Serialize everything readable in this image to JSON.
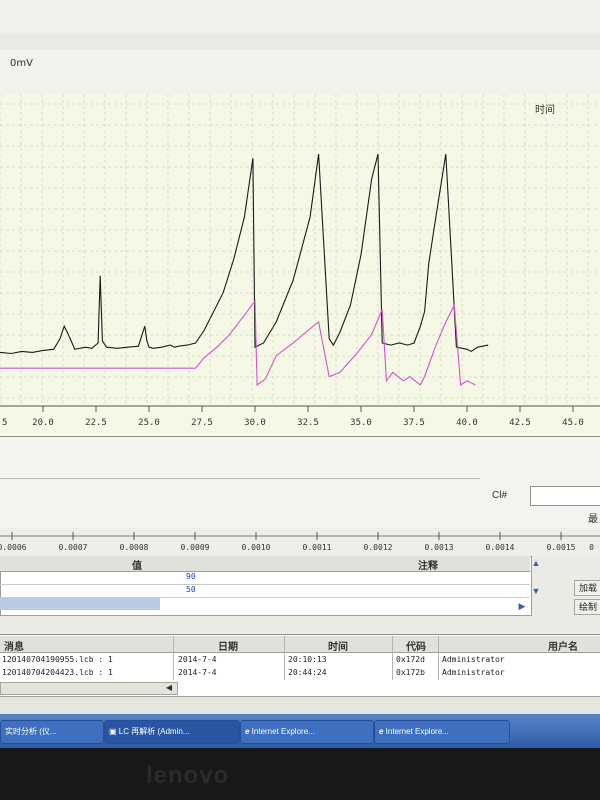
{
  "chart": {
    "ylabel": "0mV",
    "xlabel_right": "时间",
    "x_ticks": [
      "20.0",
      "22.5",
      "25.0",
      "27.5",
      "30.0",
      "32.5",
      "35.0",
      "37.5",
      "40.0",
      "42.5",
      "45.0"
    ],
    "left_tick_fragment": "5"
  },
  "chart_data": {
    "type": "line",
    "xlabel": "时间",
    "ylabel": "0mV",
    "xlim": [
      17.5,
      46.0
    ],
    "series": [
      {
        "name": "",
        "color": "#1a1a1a",
        "x": [
          17.5,
          18.0,
          18.5,
          19.0,
          19.5,
          20.0,
          20.5,
          20.8,
          21.0,
          21.2,
          21.5,
          22.0,
          22.3,
          22.6,
          22.7,
          22.8,
          23.0,
          23.5,
          24.0,
          24.5,
          24.8,
          24.9,
          25.0,
          25.2,
          25.6,
          26.0,
          26.2,
          26.4,
          26.8,
          27.2,
          27.6,
          28.0,
          28.5,
          29.0,
          29.5,
          29.9,
          30.0,
          30.4,
          31.0,
          31.8,
          32.6,
          33.0,
          33.5,
          33.7,
          34.0,
          34.5,
          35.0,
          35.5,
          35.8,
          36.0,
          36.4,
          36.8,
          37.2,
          37.5,
          37.8,
          38.0,
          38.2,
          38.5,
          39.0,
          39.5,
          40.0,
          40.2,
          40.5,
          41.0
        ],
        "y": [
          5,
          5.5,
          5,
          6,
          5.5,
          6.5,
          7,
          12,
          18,
          14,
          7,
          8,
          7.5,
          10,
          42,
          11,
          8,
          7.5,
          8,
          8.5,
          18,
          11,
          8,
          7.5,
          8,
          9,
          8,
          8.5,
          9,
          10,
          16,
          24,
          34,
          50,
          70,
          98,
          8,
          10,
          20,
          40,
          70,
          100,
          12,
          9,
          15,
          28,
          52,
          88,
          100,
          10,
          9,
          10,
          9,
          10,
          18,
          25,
          48,
          68,
          100,
          8,
          7,
          6,
          8,
          9
        ]
      },
      {
        "name": "",
        "color": "#d454c9",
        "x": [
          17.5,
          20.0,
          25.0,
          27.2,
          27.6,
          28.2,
          28.8,
          29.4,
          30.0,
          30.1,
          30.5,
          31.0,
          31.8,
          32.5,
          33.0,
          33.5,
          34.0,
          34.8,
          35.5,
          36.0,
          36.2,
          36.5,
          37.0,
          37.3,
          37.8,
          38.0,
          38.5,
          39.0,
          39.4,
          39.7,
          40.0,
          40.4
        ],
        "y": [
          -2,
          -2,
          -2,
          -2,
          3,
          8,
          14,
          22,
          30,
          -10,
          -7,
          4,
          10,
          16,
          20,
          -6,
          -4,
          5,
          14,
          26,
          -8,
          -4,
          -8,
          -6,
          -10,
          -6,
          8,
          20,
          28,
          -10,
          -8,
          -10
        ]
      }
    ]
  },
  "ruler": {
    "ticks": [
      "0.0006",
      "0.0007",
      "0.0008",
      "0.0009",
      "0.0010",
      "0.0011",
      "0.0012",
      "0.0013",
      "0.0014",
      "0.0015",
      "0"
    ]
  },
  "form": {
    "field_label": "Cl#",
    "right_fragment": "最"
  },
  "value_table": {
    "header_value": "值",
    "header_note": "注释",
    "rows": [
      "90",
      "50"
    ]
  },
  "buttons": {
    "load": "加载",
    "draw": "绘制"
  },
  "log_table": {
    "headers": [
      "消息",
      "日期",
      "时间",
      "代码",
      "用户名"
    ],
    "rows": [
      {
        "message": "120140704190955.lcb : 1",
        "date": "2014-7-4",
        "time": "20:10:13",
        "code": "0x172d",
        "user": "Administrator"
      },
      {
        "message": "120140704204423.lcb : 1",
        "date": "2014-7-4",
        "time": "20:44:24",
        "code": "0x172b",
        "user": "Administrator"
      }
    ]
  },
  "taskbar": {
    "items": [
      "实时分析 (仪...",
      "LC 再解析 (Admin...",
      "Internet Explore...",
      "Internet Explore..."
    ]
  },
  "bezel": {
    "brand": "lenovo"
  }
}
